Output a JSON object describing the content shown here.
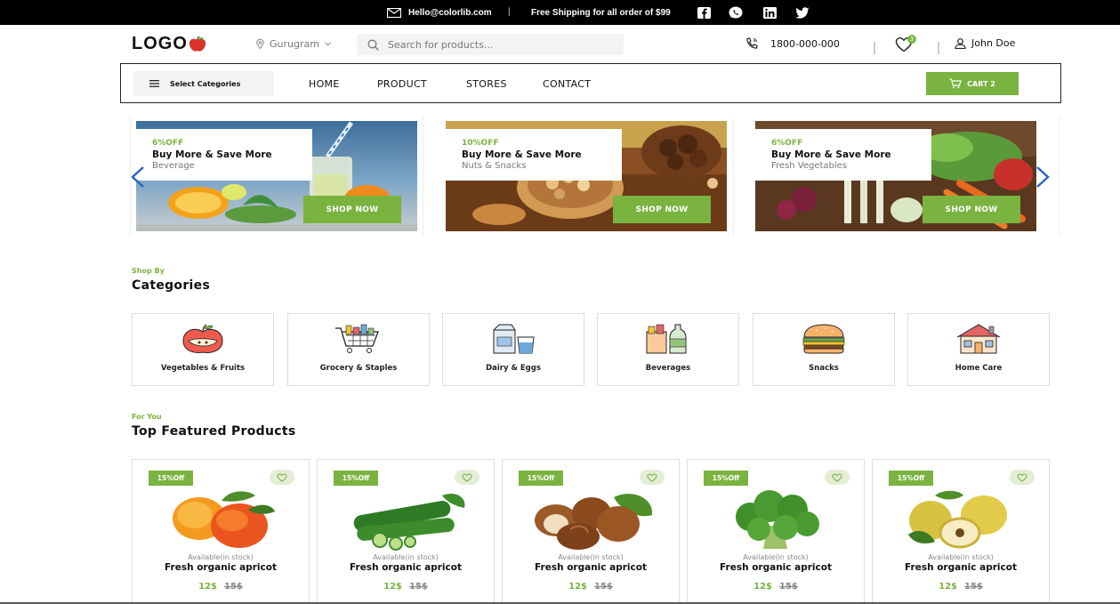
{
  "topbar": {
    "email": "Hello@colorlib.com",
    "separator": "|",
    "shipping": "Free Shipping for all order of $99",
    "social": [
      "facebook-icon",
      "whatsapp-icon",
      "linkedin-icon",
      "twitter-icon"
    ]
  },
  "header": {
    "logo": "LOGO",
    "location": "Gurugram",
    "search_placeholder": "Search for products...",
    "phone": "1800-000-000",
    "wishlist_count": "3",
    "user": "John Doe"
  },
  "nav": {
    "select_categories": "Select Categories",
    "links": [
      "HOME",
      "PRODUCT",
      "STORES",
      "CONTACT"
    ],
    "cart": "CART 2"
  },
  "banners": [
    {
      "offer": "6%OFF",
      "title": "Buy More & Save More",
      "subtitle": "Beverage",
      "button": "SHOP NOW"
    },
    {
      "offer": "10%OFF",
      "title": "Buy More & Save More",
      "subtitle": "Nuts & Snacks",
      "button": "SHOP NOW"
    },
    {
      "offer": "6%OFF",
      "title": "Buy More & Save More",
      "subtitle": "Fresh Vegetables",
      "button": "SHOP NOW"
    }
  ],
  "categories_section": {
    "kicker": "Shop By",
    "title": "Categories",
    "items": [
      {
        "label": "Vegetables & Fruits",
        "icon": "apple-icon"
      },
      {
        "label": "Grocery & Staples",
        "icon": "shopping-cart-icon"
      },
      {
        "label": "Dairy & Eggs",
        "icon": "milk-icon"
      },
      {
        "label": "Beverages",
        "icon": "drinks-icon"
      },
      {
        "label": "Snacks",
        "icon": "burger-icon"
      },
      {
        "label": "Home Care",
        "icon": "house-icon"
      }
    ]
  },
  "featured_section": {
    "kicker": "For You",
    "title": "Top Featured Products",
    "products": [
      {
        "discount": "15%Off",
        "availability": "Available(in stock)",
        "name": "Fresh organic apricot",
        "price": "12$",
        "old_price": "15$",
        "image": "apricot"
      },
      {
        "discount": "15%Off",
        "availability": "Available(in stock)",
        "name": "Fresh organic apricot",
        "price": "12$",
        "old_price": "15$",
        "image": "cucumber"
      },
      {
        "discount": "15%Off",
        "availability": "Available(in stock)",
        "name": "Fresh organic apricot",
        "price": "12$",
        "old_price": "15$",
        "image": "hazelnut"
      },
      {
        "discount": "15%Off",
        "availability": "Available(in stock)",
        "name": "Fresh organic apricot",
        "price": "12$",
        "old_price": "15$",
        "image": "broccoli"
      },
      {
        "discount": "15%Off",
        "availability": "Available(in stock)",
        "name": "Fresh organic apricot",
        "price": "12$",
        "old_price": "15$",
        "image": "quince"
      }
    ]
  },
  "colors": {
    "accent": "#7ab340",
    "topbar": "#000000"
  }
}
